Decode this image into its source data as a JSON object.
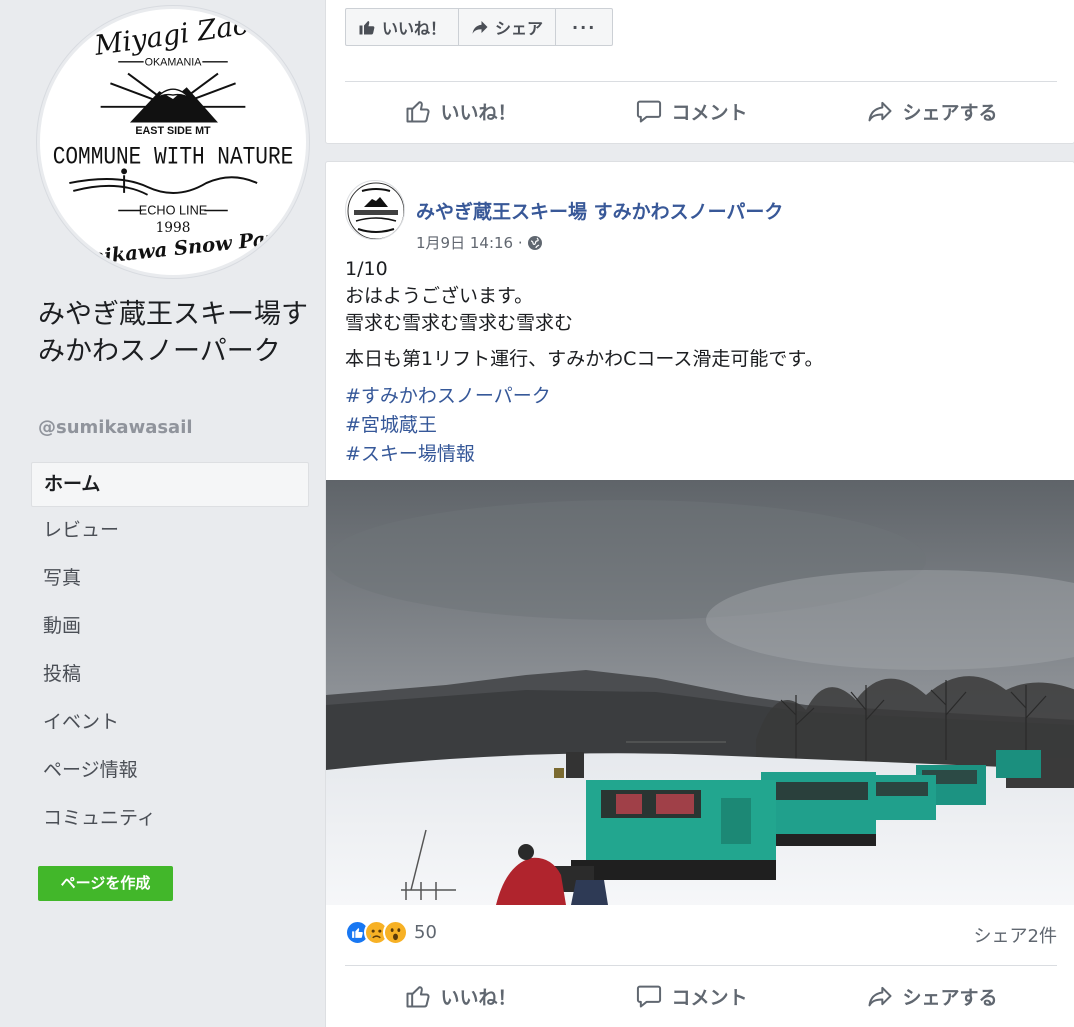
{
  "sidebar": {
    "logo_text": {
      "top": "Miyagi Zao",
      "sub": "OKAMANIA",
      "east": "EAST SIDE MT",
      "main": "COMMUNE WITH NATURE",
      "echo": "ECHO LINE",
      "year": "1998",
      "bottom": "Sumikawa Snow Park"
    },
    "page_name": "みやぎ蔵王スキー場すみかわスノーパーク",
    "handle": "@sumikawasail",
    "nav": [
      {
        "label": "ホーム",
        "active": true
      },
      {
        "label": "レビュー"
      },
      {
        "label": "写真"
      },
      {
        "label": "動画"
      },
      {
        "label": "投稿"
      },
      {
        "label": "イベント"
      },
      {
        "label": "ページ情報"
      },
      {
        "label": "コミュニティ"
      }
    ],
    "create_page": "ページを作成"
  },
  "top_card": {
    "like_btn": "いいね！",
    "share_btn": "シェア",
    "more_btn": "···",
    "actions": {
      "like": "いいね！",
      "comment": "コメント",
      "share": "シェアする"
    }
  },
  "post": {
    "author": "みやぎ蔵王スキー場 すみかわスノーパーク",
    "time": "1月9日 14:16 ·",
    "privacy_icon": "globe-icon",
    "lines": [
      "1/10",
      "おはようございます。",
      "雪求む雪求む雪求む雪求む"
    ],
    "line2": "本日も第1リフト運行、すみかわCコース滑走可能です。",
    "hashtags": [
      "#すみかわスノーパーク",
      "#宮城蔵王",
      "#スキー場情報"
    ],
    "reaction_count": "50",
    "share_count": "シェア2件",
    "actions": {
      "like": "いいね！",
      "comment": "コメント",
      "share": "シェアする"
    }
  },
  "colors": {
    "link": "#385898",
    "green": "#42b72a",
    "like_blue": "#1877f2",
    "haha_yellow": "#f7b125"
  }
}
